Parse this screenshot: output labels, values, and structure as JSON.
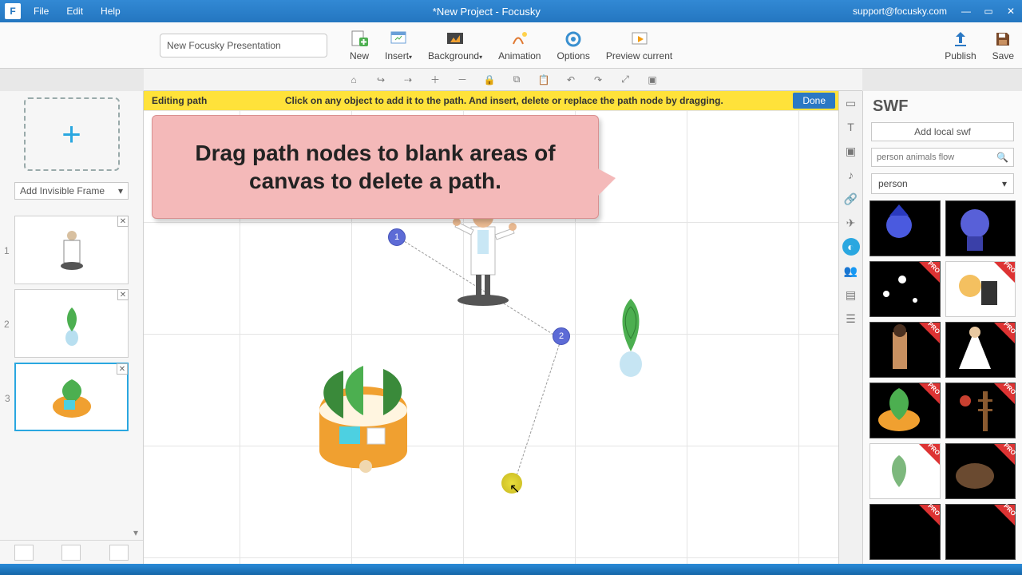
{
  "app": {
    "title": "*New Project - Focusky",
    "account": "support@focusky.com"
  },
  "menubar": {
    "file": "File",
    "edit": "Edit",
    "help": "Help"
  },
  "ribbon": {
    "title_input": "New Focusky Presentation",
    "new": "New",
    "insert": "Insert",
    "background": "Background",
    "animation": "Animation",
    "options": "Options",
    "preview": "Preview current",
    "publish": "Publish",
    "save": "Save"
  },
  "left": {
    "add_invisible": "Add Invisible Frame",
    "thumbs": [
      {
        "idx": "1",
        "selected": false
      },
      {
        "idx": "2",
        "selected": false
      },
      {
        "idx": "3",
        "selected": true
      }
    ]
  },
  "hint": {
    "label": "Editing path",
    "message": "Click on any object to add it to the path. And insert, delete or replace the path node by dragging.",
    "done": "Done"
  },
  "callout": {
    "text": "Drag path nodes to blank areas of canvas to delete a path."
  },
  "nodes": {
    "n1": "1",
    "n2": "2"
  },
  "rightpanel": {
    "title": "SWF",
    "add_local": "Add local swf",
    "search_placeholder": "person animals flow",
    "category": "person"
  }
}
